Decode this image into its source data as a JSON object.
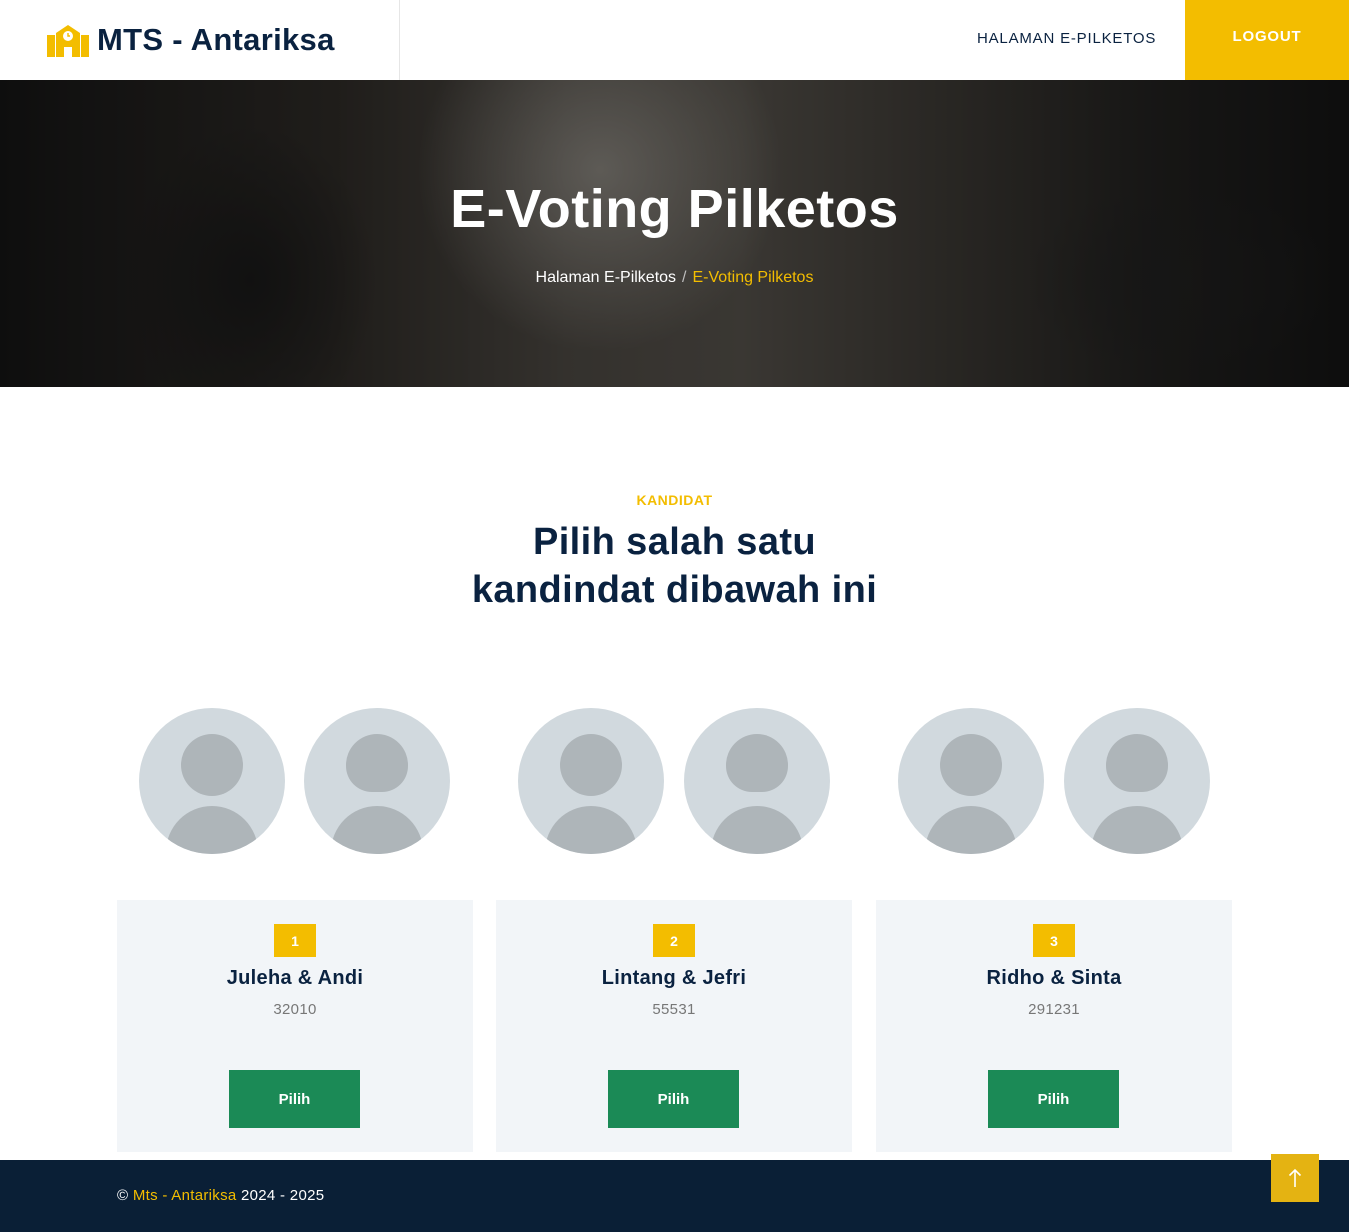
{
  "header": {
    "brand_name": "MTS - Antariksa",
    "nav_link": "HALAMAN E-PILKETOS",
    "logout_label": "LOGOUT"
  },
  "hero": {
    "title": "E-Voting Pilketos",
    "breadcrumb": {
      "home": "Halaman E-Pilketos",
      "separator": "/",
      "current": "E-Voting Pilketos"
    }
  },
  "section": {
    "label": "KANDIDAT",
    "title_line1": "Pilih salah satu",
    "title_line2": "kandindat dibawah ini"
  },
  "candidates": [
    {
      "number": "1",
      "name": "Juleha & Andi",
      "code": "32010",
      "button": "Pilih"
    },
    {
      "number": "2",
      "name": "Lintang & Jefri",
      "code": "55531",
      "button": "Pilih"
    },
    {
      "number": "3",
      "name": "Ridho & Sinta",
      "code": "291231",
      "button": "Pilih"
    }
  ],
  "footer": {
    "copyright_symbol": "©",
    "brand": "Mts - Antariksa",
    "years": "2024 - 2025"
  },
  "colors": {
    "accent": "#f3bd00",
    "navy": "#0a2240",
    "button_green": "#1b8a56",
    "card_bg": "#f2f5f8",
    "footer_bg": "#0a1f36"
  },
  "icons": {
    "brand": "school-building-icon",
    "scroll_top": "arrow-up-icon",
    "avatar": "user-placeholder-icon"
  }
}
